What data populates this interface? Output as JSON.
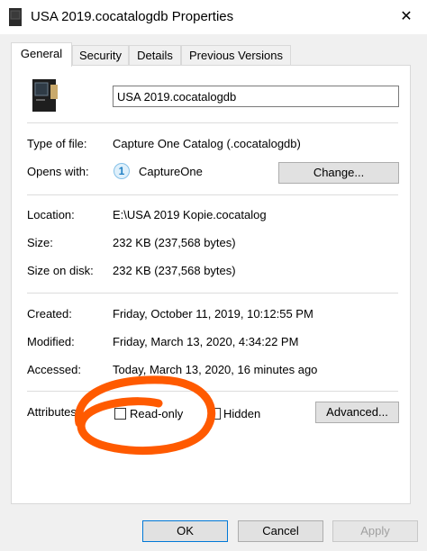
{
  "window": {
    "title": "USA 2019.cocatalogdb Properties",
    "close_glyph": "✕"
  },
  "tabs": [
    {
      "label": "General",
      "active": true
    },
    {
      "label": "Security",
      "active": false
    },
    {
      "label": "Details",
      "active": false
    },
    {
      "label": "Previous Versions",
      "active": false
    }
  ],
  "general": {
    "file_name": "USA 2019.cocatalogdb",
    "type_label": "Type of file:",
    "type_value": "Capture One Catalog (.cocatalogdb)",
    "opens_label": "Opens with:",
    "opens_app_icon": "1",
    "opens_value": "CaptureOne",
    "change_button": "Change...",
    "location_label": "Location:",
    "location_value": "E:\\USA 2019 Kopie.cocatalog",
    "size_label": "Size:",
    "size_value": "232 KB (237,568 bytes)",
    "size_on_disk_label": "Size on disk:",
    "size_on_disk_value": "232 KB (237,568 bytes)",
    "created_label": "Created:",
    "created_value": "Friday, October 11, 2019, 10:12:55 PM",
    "modified_label": "Modified:",
    "modified_value": "Friday, March 13, 2020, 4:34:22 PM",
    "accessed_label": "Accessed:",
    "accessed_value": "Today, March 13, 2020, 16 minutes ago",
    "attributes_label": "Attributes:",
    "readonly_label": "Read-only",
    "readonly_checked": false,
    "hidden_label": "Hidden",
    "hidden_checked": false,
    "advanced_button": "Advanced..."
  },
  "footer": {
    "ok_button": "OK",
    "cancel_button": "Cancel",
    "apply_button": "Apply",
    "apply_enabled": false
  },
  "colors": {
    "annotation": "#ff5a00",
    "accent": "#0078d7"
  }
}
